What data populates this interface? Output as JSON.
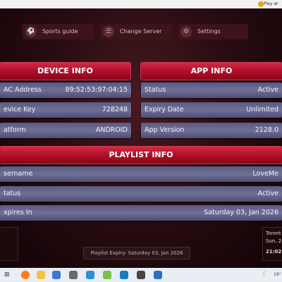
{
  "topbar": {
    "text": "Play ar"
  },
  "menu": {
    "items": [
      {
        "label": "Sports guide",
        "icon": "soccer-ball-icon"
      },
      {
        "label": "Change Server",
        "icon": "list-icon"
      },
      {
        "label": "Settings",
        "icon": "gear-icon"
      }
    ]
  },
  "device_info": {
    "title": "DEVICE INFO",
    "rows": [
      {
        "key": "AC Address",
        "value": "89:52:53:97:04:15"
      },
      {
        "key": "evice Key",
        "value": "728248"
      },
      {
        "key": "atform",
        "value": "ANDROID"
      }
    ]
  },
  "app_info": {
    "title": "APP INFO",
    "rows": [
      {
        "key": "Status",
        "value": "Active"
      },
      {
        "key": "Expiry Date",
        "value": "Unlimited"
      },
      {
        "key": "App Version",
        "value": "2128.0"
      }
    ]
  },
  "playlist_info": {
    "title": "PLAYLIST INFO",
    "rows": [
      {
        "key": "sername",
        "value": "LoveMe"
      },
      {
        "key": "tatus",
        "value": "Active"
      },
      {
        "key": "xpires In",
        "value": "Saturday 03, Jan 2026"
      }
    ]
  },
  "footer": {
    "playlist_expiry": "Playlist Expiry: Saturday 03, Jan 2026",
    "clock_city": "Toront",
    "clock_date": "Sun, 2",
    "clock_time": "21:02"
  },
  "taskbar": {
    "temp_text": "19°"
  }
}
